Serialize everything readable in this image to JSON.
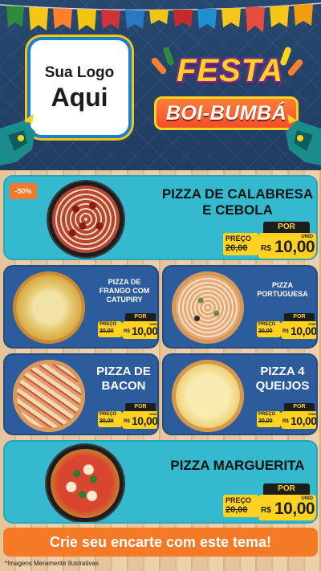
{
  "header": {
    "logo_line1": "Sua Logo",
    "logo_line2": "Aqui",
    "title_line1": "FESTA",
    "title_line2": "BOI-BUMBÁ"
  },
  "products": [
    {
      "name_lines": [
        "PIZZA DE CALABRESA",
        "E CEBOLA"
      ],
      "badge": "-50%",
      "por": "POR",
      "preco": "PREÇO",
      "old_price": "20,00",
      "currency": "R$",
      "price": "10,00",
      "unit": "UNID"
    },
    {
      "name_lines": [
        "PIZZA DE",
        "FRANGO COM",
        "CATUPIRY"
      ],
      "por": "POR",
      "preco": "PREÇO",
      "old_price": "20,00",
      "currency": "R$",
      "price": "10,00",
      "unit": "UNID"
    },
    {
      "name_lines": [
        "PIZZA",
        "PORTUGUESA"
      ],
      "por": "POR",
      "preco": "PREÇO",
      "old_price": "20,00",
      "currency": "R$",
      "price": "10,00",
      "unit": "UNID"
    },
    {
      "name_lines": [
        "PIZZA DE",
        "BACON"
      ],
      "por": "POR",
      "preco": "PREÇO",
      "old_price": "20,00",
      "currency": "R$",
      "price": "10,00",
      "unit": "UNID"
    },
    {
      "name_lines": [
        "PIZZA 4",
        "QUEIJOS"
      ],
      "por": "POR",
      "preco": "PREÇO",
      "old_price": "20,00",
      "currency": "R$",
      "price": "10,00",
      "unit": "UNID"
    },
    {
      "name_lines": [
        "PIZZA MARGUERITA"
      ],
      "por": "POR",
      "preco": "PREÇO",
      "old_price": "20,00",
      "currency": "R$",
      "price": "10,00",
      "unit": "UNID"
    }
  ],
  "footer": {
    "cta": "Crie seu encarte com este tema!",
    "disclaimer": "*Imagens Meramente Ilustrativas"
  },
  "colors": {
    "header_bg": "#213d62",
    "big_card": "#35b9cf",
    "small_card": "#2c5c9c",
    "price_yellow": "#ffd21f",
    "cta_orange": "#f57a27"
  }
}
